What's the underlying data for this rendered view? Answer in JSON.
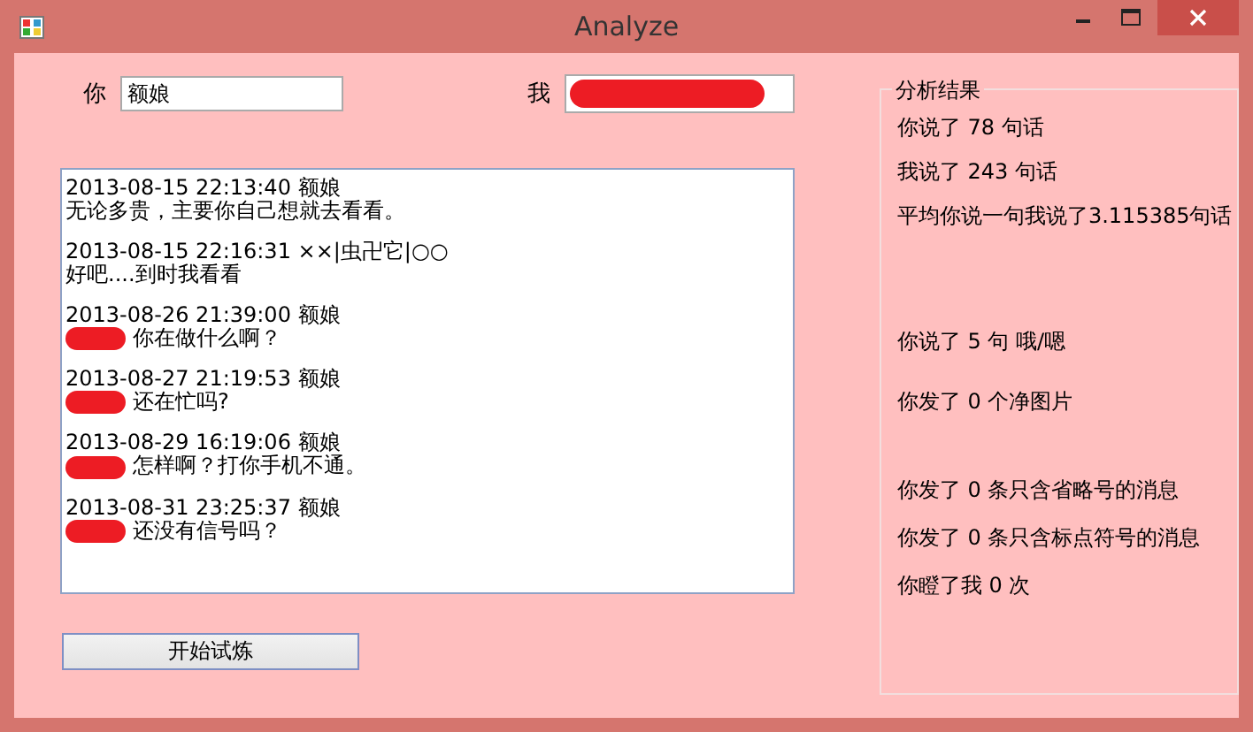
{
  "window": {
    "title": "Analyze"
  },
  "you_field": {
    "label": "你",
    "value": "额娘"
  },
  "me_field": {
    "label": "我",
    "redacted": true
  },
  "messages": [
    {
      "header": "2013-08-15 22:13:40 额娘",
      "redacted": false,
      "text": "无论多贵，主要你自己想就去看看。"
    },
    {
      "header": "2013-08-15 22:16:31 ××|虫卍它|○○",
      "redacted": false,
      "text": "好吧....到时我看看"
    },
    {
      "header": "2013-08-26 21:39:00 额娘",
      "redacted": true,
      "text": "你在做什么啊？"
    },
    {
      "header": "2013-08-27 21:19:53 额娘",
      "redacted": true,
      "text": "还在忙吗?"
    },
    {
      "header": "2013-08-29 16:19:06 额娘",
      "redacted": true,
      "text": "怎样啊？打你手机不通。"
    },
    {
      "header": "2013-08-31 23:25:37 额娘",
      "redacted": true,
      "text": "还没有信号吗？"
    }
  ],
  "start_button": "开始试炼",
  "results": {
    "title": "分析结果",
    "sections": [
      [
        "你说了 78 句话",
        "我说了 243 句话",
        "平均你说一句我说了3.115385句话"
      ],
      [
        "你说了 5 句  哦/嗯",
        "你发了 0 个净图片"
      ],
      [
        "你发了 0 条只含省略号的消息",
        "你发了 0 条只含标点符号的消息",
        "你瞪了我 0 次"
      ]
    ]
  }
}
